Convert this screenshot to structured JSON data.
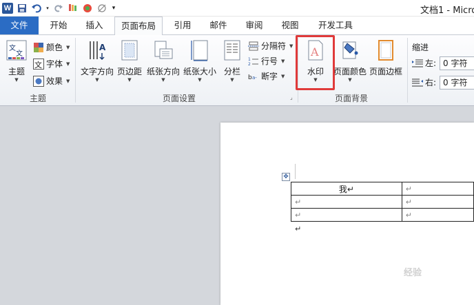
{
  "window": {
    "title": "文档1 - Micro"
  },
  "qat": {
    "icons": [
      "word-logo-icon",
      "save-icon",
      "undo-icon",
      "redo-icon",
      "format-painter-icon",
      "color-icon",
      "clear-format-icon",
      "customize-qat-icon"
    ],
    "logo_letter": "W"
  },
  "tabs": [
    {
      "label": "文件"
    },
    {
      "label": "开始"
    },
    {
      "label": "插入"
    },
    {
      "label": "页面布局"
    },
    {
      "label": "引用"
    },
    {
      "label": "邮件"
    },
    {
      "label": "审阅"
    },
    {
      "label": "视图"
    },
    {
      "label": "开发工具"
    }
  ],
  "ribbon": {
    "theme_group": {
      "label": "主题",
      "theme_button": "主题",
      "colors": "颜色",
      "fonts": "字体",
      "effects": "效果"
    },
    "page_setup_group": {
      "label": "页面设置",
      "text_direction": "文字方向",
      "margins": "页边距",
      "orientation": "纸张方向",
      "size": "纸张大小",
      "columns": "分栏",
      "breaks": "分隔符",
      "line_numbers": "行号",
      "hyphenation": "断字"
    },
    "page_background_group": {
      "label": "页面背景",
      "watermark": "水印",
      "page_color": "页面颜色",
      "page_borders": "页面边框"
    },
    "paragraph_group": {
      "indent_label": "缩进",
      "left_label": "左:",
      "left_value": "0 字符",
      "right_label": "右:",
      "right_value": "0 字符"
    }
  },
  "document": {
    "table": [
      [
        "我↵",
        "↵"
      ],
      [
        "↵",
        "↵"
      ],
      [
        "↵",
        "↵"
      ]
    ],
    "after_table_mark": "↵"
  },
  "overlay": {
    "watermark_text": "经验"
  },
  "colors": {
    "accent_file_tab": "#2b6cc4",
    "highlight_box": "#e03a3a"
  }
}
